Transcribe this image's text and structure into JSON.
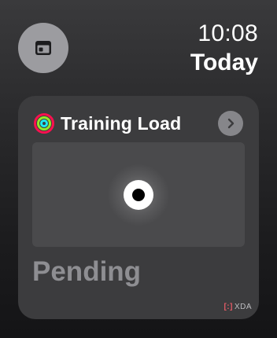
{
  "status_bar": {
    "time": "10:08",
    "day": "Today"
  },
  "widget_button": {
    "icon": "widget-icon"
  },
  "card": {
    "icon": "activity-rings-icon",
    "title": "Training Load",
    "chevron_icon": "chevron-right-icon",
    "status": "Pending"
  },
  "watermark": {
    "mark": "[:]",
    "text": "XDA"
  },
  "colors": {
    "ring_move": "#fa114f",
    "ring_exercise": "#92e82a",
    "ring_stand": "#1eeaef",
    "status_text": "#8e8e92",
    "card_background": "#3c3c3e"
  }
}
